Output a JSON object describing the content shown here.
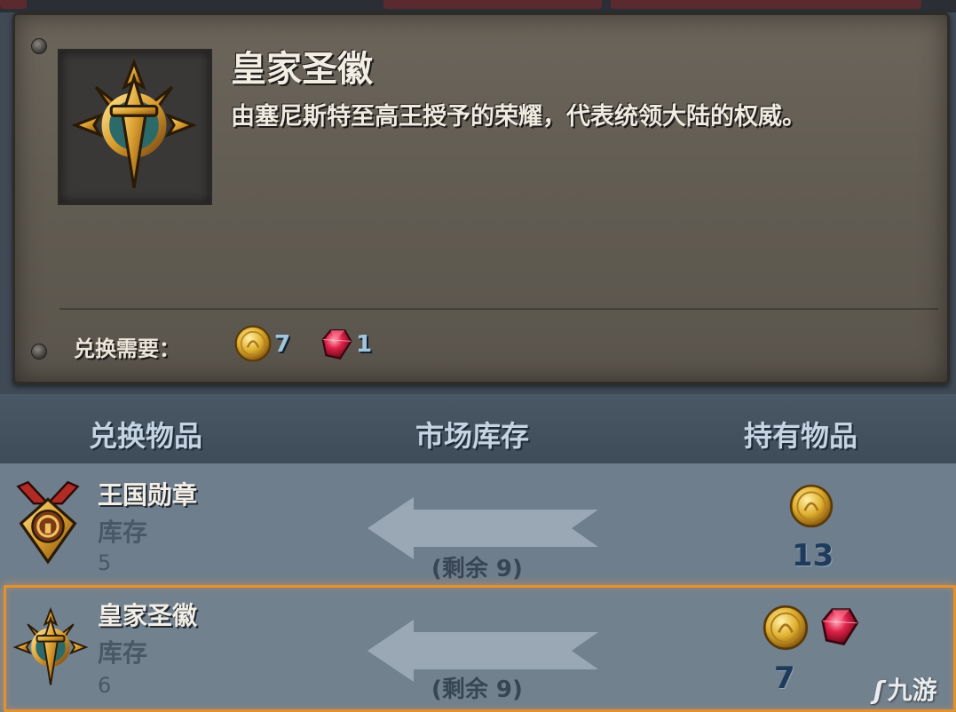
{
  "item": {
    "name": "皇家圣徽",
    "description": "由塞尼斯特至高王授予的荣耀，代表统领大陆的权威。",
    "icon": "royal-holy-emblem-icon"
  },
  "cost": {
    "label": "兑换需要：",
    "items": [
      {
        "icon": "gold-coin-icon",
        "count": "7"
      },
      {
        "icon": "red-gem-icon",
        "count": "1"
      }
    ]
  },
  "columns": {
    "exchange": "兑换物品",
    "market": "市场库存",
    "held": "持有物品"
  },
  "rows": [
    {
      "name": "王国勋章",
      "stock_label": "库存",
      "stock": "5",
      "remaining": "(剩余 9)",
      "held_count": "13",
      "icon": "kingdom-medal-icon",
      "held_icons": [
        "gold-coin-icon"
      ]
    },
    {
      "name": "皇家圣徽",
      "stock_label": "库存",
      "stock": "6",
      "remaining": "(剩余 9)",
      "held_count": "7",
      "icon": "royal-holy-emblem-icon",
      "held_icons": [
        "gold-coin-icon",
        "red-gem-icon"
      ],
      "selected": true
    }
  ],
  "watermark": "九游",
  "colors": {
    "selection": "#e3912f",
    "count_blue": "#9fc6de",
    "gold": "#d9a63a",
    "gem": "#c8143a"
  }
}
